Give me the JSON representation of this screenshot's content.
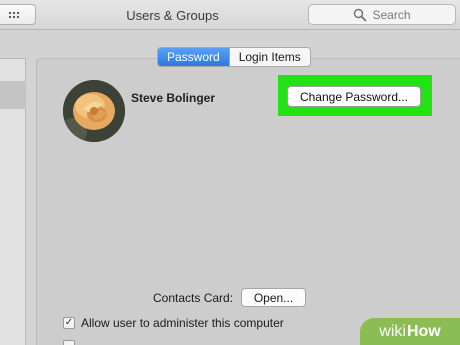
{
  "window": {
    "title": "Users & Groups"
  },
  "search": {
    "placeholder": "Search"
  },
  "tabs": [
    {
      "label": "Password",
      "active": true
    },
    {
      "label": "Login Items",
      "active": false
    }
  ],
  "user": {
    "name": "Steve Bolinger"
  },
  "buttons": {
    "change_password": "Change Password...",
    "open": "Open..."
  },
  "contacts": {
    "label": "Contacts Card:"
  },
  "admin": {
    "label": "Allow user to administer this computer",
    "checked": true,
    "check_glyph": "✓"
  },
  "watermark": {
    "part1": "wiki",
    "part2": "How"
  },
  "colors": {
    "highlight": "#21e314",
    "tab_active": "#2d79e0",
    "watermark": "#8cbd54"
  },
  "icons": [
    "grid-icon",
    "search-icon",
    "user-avatar-rose"
  ]
}
